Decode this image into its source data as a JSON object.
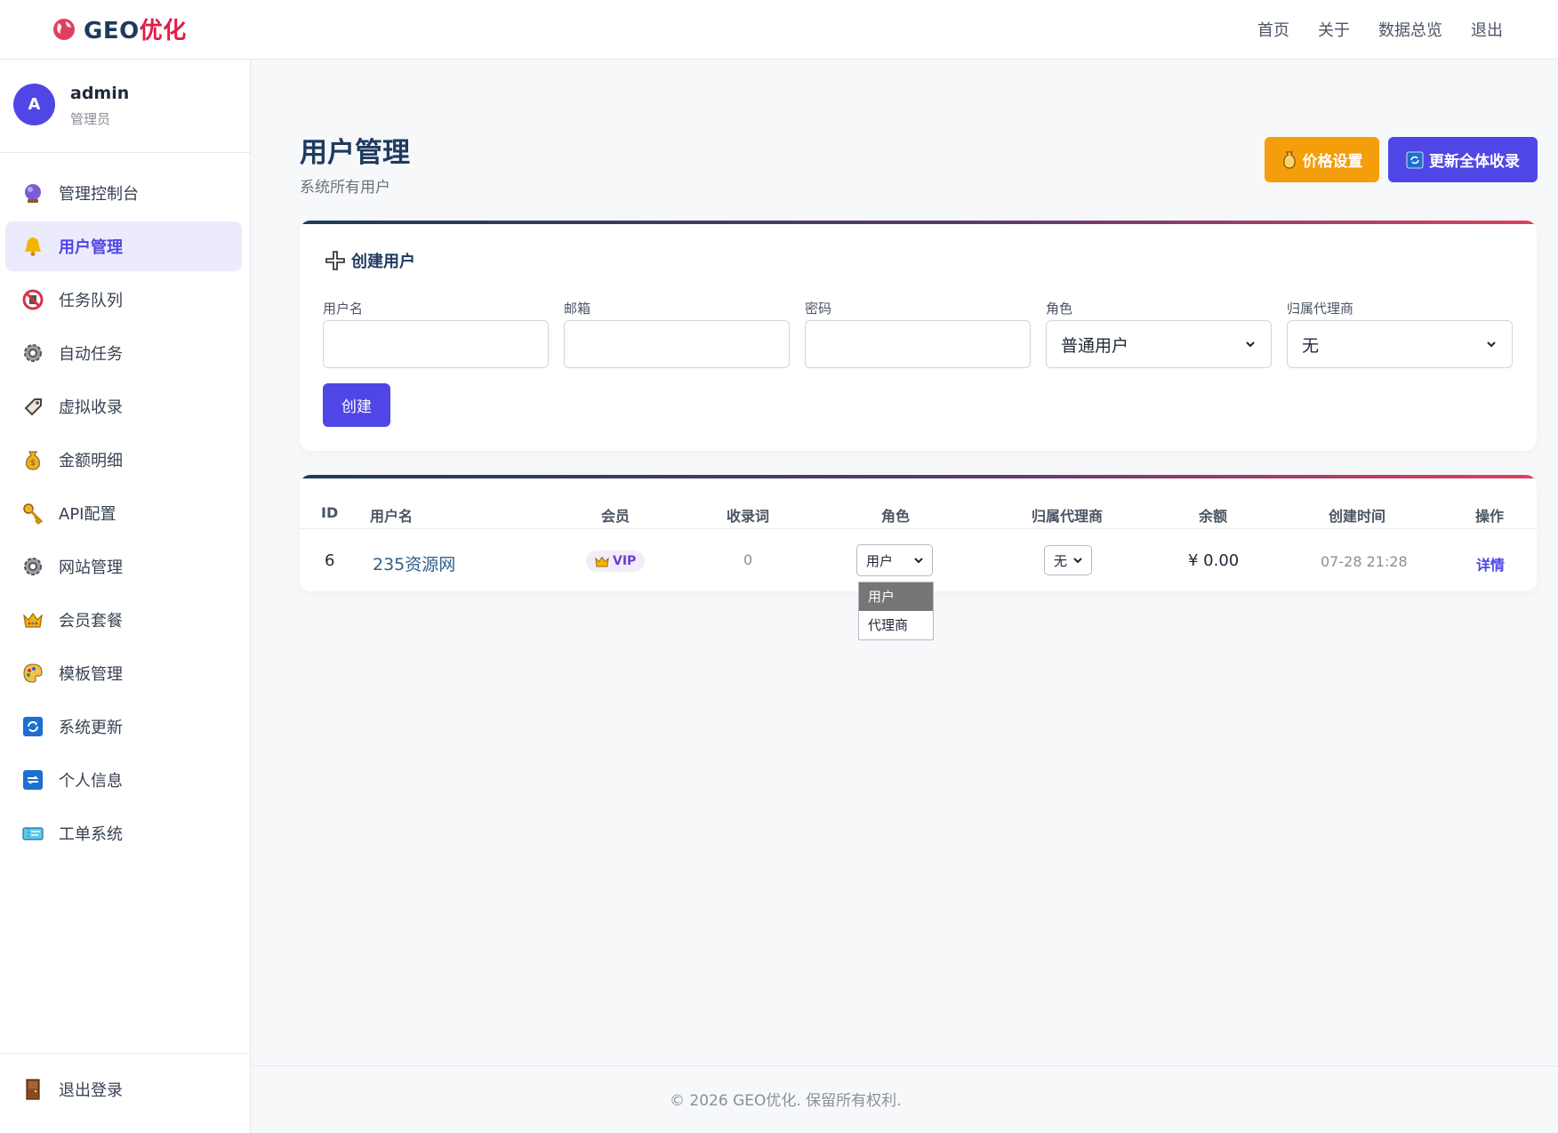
{
  "brand": {
    "part1": "GEO",
    "part2": "优化"
  },
  "topnav": [
    "首页",
    "关于",
    "数据总览",
    "退出"
  ],
  "user": {
    "avatar_letter": "A",
    "name": "admin",
    "role": "管理员"
  },
  "sidebar": {
    "items": [
      {
        "label": "管理控制台",
        "icon": "crystal-ball-icon"
      },
      {
        "label": "用户管理",
        "icon": "bell-icon",
        "active": true
      },
      {
        "label": "任务队列",
        "icon": "no-entry-icon"
      },
      {
        "label": "自动任务",
        "icon": "gear-icon"
      },
      {
        "label": "虚拟收录",
        "icon": "tag-icon"
      },
      {
        "label": "金额明细",
        "icon": "money-bag-icon"
      },
      {
        "label": "API配置",
        "icon": "key-icon"
      },
      {
        "label": "网站管理",
        "icon": "gear-icon"
      },
      {
        "label": "会员套餐",
        "icon": "crown-icon"
      },
      {
        "label": "模板管理",
        "icon": "palette-icon"
      },
      {
        "label": "系统更新",
        "icon": "refresh-icon"
      },
      {
        "label": "个人信息",
        "icon": "repeat-icon"
      },
      {
        "label": "工单系统",
        "icon": "ticket-icon"
      }
    ],
    "logout_label": "退出登录"
  },
  "page": {
    "title": "用户管理",
    "subtitle": "系统所有用户"
  },
  "actions": {
    "price_label": "价格设置",
    "refresh_label": "更新全体收录"
  },
  "create_form": {
    "title": "创建用户",
    "fields": {
      "username_label": "用户名",
      "email_label": "邮箱",
      "password_label": "密码",
      "role_label": "角色",
      "role_value": "普通用户",
      "agent_label": "归属代理商",
      "agent_value": "无"
    },
    "submit_label": "创建"
  },
  "table": {
    "headers": [
      "ID",
      "用户名",
      "会员",
      "收录词",
      "角色",
      "归属代理商",
      "余额",
      "创建时间",
      "操作"
    ],
    "rows": [
      {
        "id": "6",
        "username": "235资源网",
        "member": "VIP",
        "keywords": "0",
        "role": "用户",
        "agent": "无",
        "balance": "¥ 0.00",
        "created": "07-28 21:28",
        "action": "详情"
      }
    ],
    "role_dropdown_options": [
      "用户",
      "代理商"
    ]
  },
  "footer": "© 2026 GEO优化. 保留所有权利.",
  "colors": {
    "accent": "#4f46e5",
    "warning": "#f59e0b",
    "brand_red": "#e11d48",
    "navy": "#1e3a5f"
  }
}
